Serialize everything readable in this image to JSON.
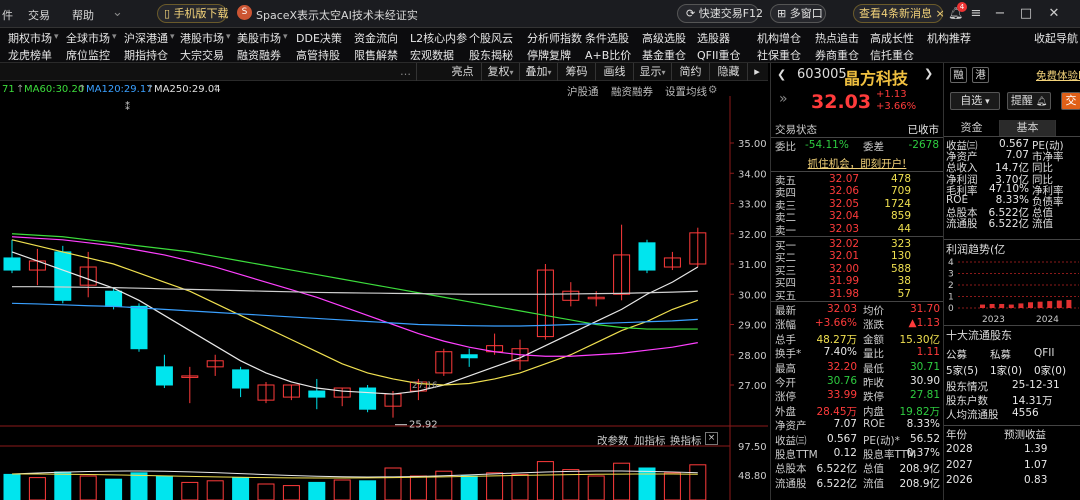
{
  "topbar": {
    "menu_partial": "件",
    "menu_trade": "交易",
    "menu_help": "帮助",
    "phone_download": "手机版下载",
    "news_ticker": "SpaceX表示太空AI技术未经证实",
    "quick_trade": "快速交易F12",
    "multi_window": "多窗口",
    "new_messages": "查看4条新消息",
    "badge_count": "4"
  },
  "nav_row1": [
    "期权市场",
    "全球市场",
    "沪深港通",
    "港股市场",
    "美股市场",
    "DDE决策",
    "资金流向",
    "L2核心内参",
    "个股风云",
    "分析师指数",
    "条件选股",
    "高级选股",
    "选股器",
    "机构增仓",
    "热点追击",
    "高成长性",
    "机构推荐",
    "收起导航"
  ],
  "nav_row2": [
    "龙虎榜单",
    "席位监控",
    "期指持仓",
    "大宗交易",
    "融资融券",
    "高管持股",
    "限售解禁",
    "宏观数据",
    "股东揭秘",
    "停牌复牌",
    "A+B比价",
    "基金重仓",
    "QFII重仓",
    "社保重仓",
    "券商重仓",
    "信托重仓"
  ],
  "chart_toolbar": {
    "buttons": [
      "叠加",
      "画线",
      "亮点",
      "复权",
      "叠加",
      "筹码",
      "画线",
      "显示",
      "简约",
      "隐藏"
    ],
    "links": [
      "沪股通",
      "融资融券",
      "设置均线"
    ]
  },
  "ma_legend": {
    "partial": "71",
    "ma60": "MA60:30.20",
    "ma120": "MA120:29.17",
    "ma250": "MA250:29.04"
  },
  "chart_data": {
    "type": "candlestick",
    "y_ticks": [
      "35.00",
      "34.00",
      "33.00",
      "32.00",
      "31.00",
      "30.00",
      "29.00",
      "28.00",
      "27.00"
    ],
    "ylim": [
      26.5,
      35.3
    ],
    "candles": [
      {
        "o": 31.2,
        "h": 31.8,
        "l": 30.7,
        "c": 30.8
      },
      {
        "o": 30.8,
        "h": 31.5,
        "l": 30.3,
        "c": 31.1
      },
      {
        "o": 31.4,
        "h": 31.6,
        "l": 29.7,
        "c": 29.8
      },
      {
        "o": 30.3,
        "h": 31.4,
        "l": 29.9,
        "c": 30.9
      },
      {
        "o": 30.1,
        "h": 30.2,
        "l": 29.5,
        "c": 29.6
      },
      {
        "o": 29.6,
        "h": 29.7,
        "l": 28.1,
        "c": 28.2
      },
      {
        "o": 27.6,
        "h": 28.0,
        "l": 26.9,
        "c": 27.0
      },
      {
        "o": 27.3,
        "h": 27.6,
        "l": 26.4,
        "c": 27.3
      },
      {
        "o": 27.6,
        "h": 28.0,
        "l": 27.3,
        "c": 27.8
      },
      {
        "o": 27.5,
        "h": 27.6,
        "l": 26.6,
        "c": 26.9
      },
      {
        "o": 26.5,
        "h": 27.1,
        "l": 26.4,
        "c": 27.0
      },
      {
        "o": 26.6,
        "h": 27.0,
        "l": 26.5,
        "c": 27.0
      },
      {
        "o": 26.8,
        "h": 27.2,
        "l": 26.2,
        "c": 26.6
      },
      {
        "o": 26.6,
        "h": 26.9,
        "l": 26.3,
        "c": 26.9
      },
      {
        "o": 26.9,
        "h": 27.0,
        "l": 26.1,
        "c": 26.2
      },
      {
        "o": 26.3,
        "h": 26.8,
        "l": 25.92,
        "c": 26.7
      },
      {
        "o": 26.8,
        "h": 27.2,
        "l": 26.5,
        "c": 27.1
      },
      {
        "o": 27.4,
        "h": 28.2,
        "l": 27.3,
        "c": 28.1
      },
      {
        "o": 28.0,
        "h": 28.2,
        "l": 27.6,
        "c": 27.9
      },
      {
        "o": 28.1,
        "h": 28.7,
        "l": 28.0,
        "c": 28.3
      },
      {
        "o": 27.8,
        "h": 28.5,
        "l": 27.5,
        "c": 28.2
      },
      {
        "o": 28.6,
        "h": 31.0,
        "l": 28.5,
        "c": 30.8
      },
      {
        "o": 29.8,
        "h": 30.4,
        "l": 29.6,
        "c": 30.1
      },
      {
        "o": 29.9,
        "h": 30.1,
        "l": 29.6,
        "c": 29.9
      },
      {
        "o": 30.0,
        "h": 32.3,
        "l": 29.8,
        "c": 31.3
      },
      {
        "o": 31.7,
        "h": 31.8,
        "l": 30.7,
        "c": 30.8
      },
      {
        "o": 30.9,
        "h": 31.4,
        "l": 30.8,
        "c": 31.2
      },
      {
        "o": 31.0,
        "h": 32.2,
        "l": 30.9,
        "c": 32.03
      }
    ],
    "ma_lines": [
      {
        "name": "MA5",
        "color": "#e8e8e8",
        "values": [
          31.4,
          31.1,
          30.8,
          30.5,
          30.2,
          29.8,
          29.3,
          28.8,
          28.3,
          27.8,
          27.4,
          27.1,
          26.9,
          26.8,
          26.75,
          26.7,
          26.8,
          27.0,
          27.3,
          27.6,
          27.9,
          28.3,
          28.7,
          29.1,
          29.5,
          30.0,
          30.4,
          30.9
        ]
      },
      {
        "name": "MA10",
        "color": "#f0e050",
        "values": [
          31.8,
          31.6,
          31.4,
          31.2,
          31.0,
          30.7,
          30.4,
          30.1,
          29.7,
          29.3,
          28.9,
          28.5,
          28.1,
          27.7,
          27.4,
          27.2,
          27.05,
          27.0,
          27.05,
          27.2,
          27.4,
          27.7,
          28.0,
          28.4,
          28.8,
          29.1,
          29.5,
          29.8
        ]
      },
      {
        "name": "MA20",
        "color": "#ff40ff",
        "values": [
          31.9,
          31.85,
          31.8,
          31.7,
          31.6,
          31.45,
          31.3,
          31.1,
          30.9,
          30.65,
          30.4,
          30.15,
          29.9,
          29.6,
          29.3,
          29.0,
          28.7,
          28.45,
          28.25,
          28.1,
          28.0,
          27.95,
          27.95,
          28.0,
          28.05,
          28.15,
          28.25,
          28.4
        ]
      },
      {
        "name": "MA60",
        "color": "#3cdc3c",
        "values": [
          32.0,
          31.95,
          31.9,
          31.8,
          31.7,
          31.6,
          31.5,
          31.4,
          31.25,
          31.1,
          30.95,
          30.8,
          30.65,
          30.5,
          30.35,
          30.2,
          30.05,
          29.9,
          29.75,
          29.6,
          29.45,
          29.3,
          29.15,
          29.0,
          28.9,
          28.85,
          28.85,
          28.85
        ]
      },
      {
        "name": "MA120",
        "color": "#3aa0ff",
        "values": [
          29.7,
          29.68,
          29.65,
          29.62,
          29.6,
          29.55,
          29.5,
          29.45,
          29.4,
          29.35,
          29.3,
          29.25,
          29.2,
          29.15,
          29.1,
          29.05,
          29.0,
          28.98,
          28.96,
          28.95,
          28.95,
          28.97,
          29.0,
          29.03,
          29.06,
          29.09,
          29.12,
          29.17
        ]
      },
      {
        "name": "MA250",
        "color": "#d0d0d0",
        "values": [
          30.25,
          30.25,
          30.24,
          30.23,
          30.22,
          30.2,
          30.18,
          30.16,
          30.14,
          30.12,
          30.1,
          30.08,
          30.06,
          30.05,
          30.04,
          30.03,
          30.02,
          30.01,
          30.0,
          30.0,
          30.0,
          30.0,
          30.01,
          30.02,
          30.03,
          30.05,
          30.07,
          30.1
        ]
      }
    ],
    "low_annotation": "25.92",
    "mid_annotation": "27.16",
    "volume_ticks": [
      "97.50",
      "48.80"
    ],
    "volume_panel_tabs": [
      "改参数",
      "加指标",
      "换指标"
    ],
    "volume_values": [
      32,
      28,
      35,
      30,
      26,
      34,
      30,
      22,
      24,
      28,
      20,
      18,
      22,
      25,
      24,
      40,
      30,
      36,
      30,
      34,
      32,
      48,
      38,
      30,
      46,
      40,
      34,
      44
    ]
  },
  "quote": {
    "code": "603005",
    "name": "晶方科技",
    "tag1": "融",
    "tag2": "港",
    "price": "32.03",
    "change": "+1.13",
    "change_pct": "+3.66%",
    "watch_btn": "自选",
    "remind_btn": "提醒",
    "trade_btn": "交",
    "status_label": "交易状态",
    "status_value": "已收市",
    "weibi_label": "委比",
    "weibi_value": "-54.11%",
    "weicha_label": "委差",
    "weicha_value": "-2678",
    "promo": "抓住机会，即刻开户!",
    "asks": [
      {
        "label": "卖五",
        "price": "32.07",
        "vol": "478"
      },
      {
        "label": "卖四",
        "price": "32.06",
        "vol": "709"
      },
      {
        "label": "卖三",
        "price": "32.05",
        "vol": "1724"
      },
      {
        "label": "卖二",
        "price": "32.04",
        "vol": "859"
      },
      {
        "label": "卖一",
        "price": "32.03",
        "vol": "44"
      }
    ],
    "bids": [
      {
        "label": "买一",
        "price": "32.02",
        "vol": "323"
      },
      {
        "label": "买二",
        "price": "32.01",
        "vol": "130"
      },
      {
        "label": "买三",
        "price": "32.00",
        "vol": "588"
      },
      {
        "label": "买四",
        "price": "31.99",
        "vol": "38"
      },
      {
        "label": "买五",
        "price": "31.98",
        "vol": "57"
      }
    ],
    "stats": [
      {
        "l1": "最新",
        "v1": "32.03",
        "c1": "red",
        "l2": "均价",
        "v2": "31.70",
        "c2": "red"
      },
      {
        "l1": "涨幅",
        "v1": "+3.66%",
        "c1": "red",
        "l2": "涨跌",
        "v2": "▲1.13",
        "c2": "red"
      },
      {
        "l1": "总手",
        "v1": "48.27万",
        "c1": "yellow",
        "l2": "金额",
        "v2": "15.30亿",
        "c2": "yellow"
      },
      {
        "l1": "换手*",
        "v1": "7.40%",
        "c1": "white",
        "l2": "量比",
        "v2": "1.11",
        "c2": "red"
      },
      {
        "l1": "最高",
        "v1": "32.20",
        "c1": "red",
        "l2": "最低",
        "v2": "30.71",
        "c2": "green"
      },
      {
        "l1": "今开",
        "v1": "30.76",
        "c1": "green",
        "l2": "昨收",
        "v2": "30.90",
        "c2": "white"
      },
      {
        "l1": "涨停",
        "v1": "33.99",
        "c1": "red",
        "l2": "跌停",
        "v2": "27.81",
        "c2": "green"
      },
      {
        "l1": "外盘",
        "v1": "28.45万",
        "c1": "red",
        "l2": "内盘",
        "v2": "19.82万",
        "c2": "green"
      },
      {
        "l1": "净资产",
        "v1": "7.07",
        "c1": "white",
        "l2": "ROE",
        "v2": "8.33%",
        "c2": "white"
      },
      {
        "l1": "收益㈢",
        "v1": "0.567",
        "c1": "white",
        "l2": "PE(动)*",
        "v2": "56.52",
        "c2": "white"
      },
      {
        "l1": "股息TTM",
        "v1": "0.12",
        "c1": "white",
        "l2": "股息率TTM",
        "v2": "0.37%",
        "c2": "white"
      },
      {
        "l1": "总股本",
        "v1": "6.522亿",
        "c1": "white",
        "l2": "总值",
        "v2": "208.9亿",
        "c2": "white"
      },
      {
        "l1": "流通股",
        "v1": "6.522亿",
        "c1": "white",
        "l2": "流值",
        "v2": "208.9亿",
        "c2": "white"
      }
    ]
  },
  "f10": {
    "free_trial": "免费体验L",
    "tab_funds": "资金",
    "tab_basic": "基本",
    "rows": [
      {
        "l1": "收益㈢",
        "v1": "0.567",
        "l2": "PE(动)"
      },
      {
        "l1": "净资产",
        "v1": "7.07",
        "l2": "市净率"
      },
      {
        "l1": "总收入",
        "v1": "14.7亿",
        "l2": "同比"
      },
      {
        "l1": "净利润",
        "v1": "3.70亿",
        "l2": "同比"
      },
      {
        "l1": "毛利率",
        "v1": "47.10%",
        "l2": "净利率"
      },
      {
        "l1": "ROE",
        "v1": "8.33%",
        "l2": "负债率"
      },
      {
        "l1": "总股本",
        "v1": "6.522亿",
        "l2": "总值"
      },
      {
        "l1": "流通股",
        "v1": "6.522亿",
        "l2": "流值"
      }
    ],
    "profit_title": "利润趋势(亿",
    "profit_y_ticks": [
      "4",
      "3",
      "2",
      "1",
      "0"
    ],
    "profit_years": [
      "2023",
      "2024"
    ],
    "profit_bars": [
      0.3,
      0.35,
      0.35,
      0.3,
      0.4,
      0.5,
      0.55,
      0.6,
      0.65,
      0.7
    ],
    "holders_title": "十大流通股东",
    "holder_types": [
      "公募",
      "私募",
      "QFII"
    ],
    "holder_counts": [
      "5家(5)",
      "1家(0)",
      "0家(0)"
    ],
    "holder_info": [
      {
        "l": "股东情况",
        "v": "25-12-31"
      },
      {
        "l": "股东户数",
        "v": "14.31万"
      },
      {
        "l": "人均流通股",
        "v": "4556"
      }
    ],
    "eps_header": [
      "年份",
      "预测收益"
    ],
    "eps_rows": [
      {
        "y": "2028",
        "v": "1.39"
      },
      {
        "y": "2027",
        "v": "1.07"
      },
      {
        "y": "2026",
        "v": "0.83"
      }
    ]
  }
}
